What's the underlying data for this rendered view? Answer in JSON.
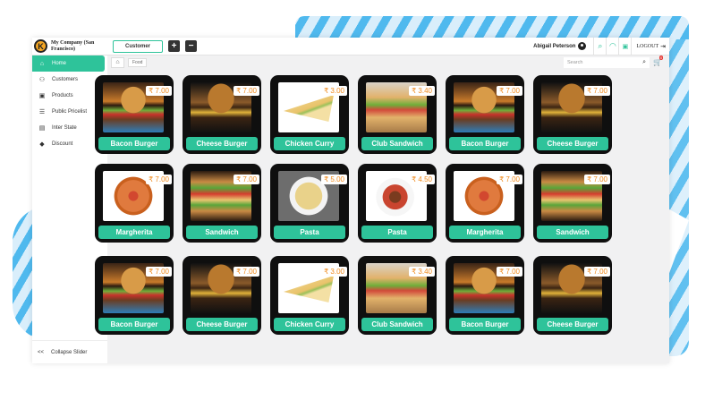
{
  "header": {
    "logo_letter": "K",
    "company_name": "My Company (San Francisco)",
    "customer_button": "Customer",
    "add_button": "+",
    "remove_button": "−",
    "user_name": "Abigail Peterson",
    "logout_label": "LOGOUT"
  },
  "sidebar": {
    "items": [
      {
        "label": "Home",
        "icon": "home-icon"
      },
      {
        "label": "Customers",
        "icon": "users-icon"
      },
      {
        "label": "Products",
        "icon": "box-icon"
      },
      {
        "label": "Public Pricelist",
        "icon": "list-icon"
      },
      {
        "label": "Inter State",
        "icon": "document-icon"
      },
      {
        "label": "Discount",
        "icon": "tag-icon"
      }
    ],
    "collapse_arrow": "<<",
    "collapse_label": "Collapse Slider"
  },
  "subbar": {
    "breadcrumb": "Food",
    "search_placeholder": "Search",
    "cart_count": "0"
  },
  "colors": {
    "accent": "#2ec39a",
    "price": "#f08a1c",
    "card": "#0f0f0f"
  },
  "products": [
    {
      "name": "Bacon Burger",
      "price": "₹ 7.00",
      "image": "f-burger"
    },
    {
      "name": "Cheese Burger",
      "price": "₹ 7.00",
      "image": "f-cheese"
    },
    {
      "name": "Chicken Curry",
      "price": "₹ 3.00",
      "image": "f-chicken"
    },
    {
      "name": "Club Sandwich",
      "price": "₹ 3.40",
      "image": "f-club"
    },
    {
      "name": "Bacon Burger",
      "price": "₹ 7.00",
      "image": "f-burger"
    },
    {
      "name": "Cheese Burger",
      "price": "₹ 7.00",
      "image": "f-cheese"
    },
    {
      "name": "Margherita",
      "price": "₹ 7.00",
      "image": "f-pizza"
    },
    {
      "name": "Sandwich",
      "price": "₹ 7.00",
      "image": "f-sandwich"
    },
    {
      "name": "Pasta",
      "price": "₹ 5.00",
      "image": "f-pasta"
    },
    {
      "name": "Pasta",
      "price": "₹ 4.50",
      "image": "f-pasta2"
    },
    {
      "name": "Margherita",
      "price": "₹ 7.00",
      "image": "f-pizza"
    },
    {
      "name": "Sandwich",
      "price": "₹ 7.00",
      "image": "f-sandwich"
    },
    {
      "name": "Bacon Burger",
      "price": "₹ 7.00",
      "image": "f-burger"
    },
    {
      "name": "Cheese Burger",
      "price": "₹ 7.00",
      "image": "f-cheese"
    },
    {
      "name": "Chicken Curry",
      "price": "₹ 3.00",
      "image": "f-chicken"
    },
    {
      "name": "Club Sandwich",
      "price": "₹ 3.40",
      "image": "f-club"
    },
    {
      "name": "Bacon Burger",
      "price": "₹ 7.00",
      "image": "f-burger"
    },
    {
      "name": "Cheese Burger",
      "price": "₹ 7.00",
      "image": "f-cheese"
    }
  ]
}
